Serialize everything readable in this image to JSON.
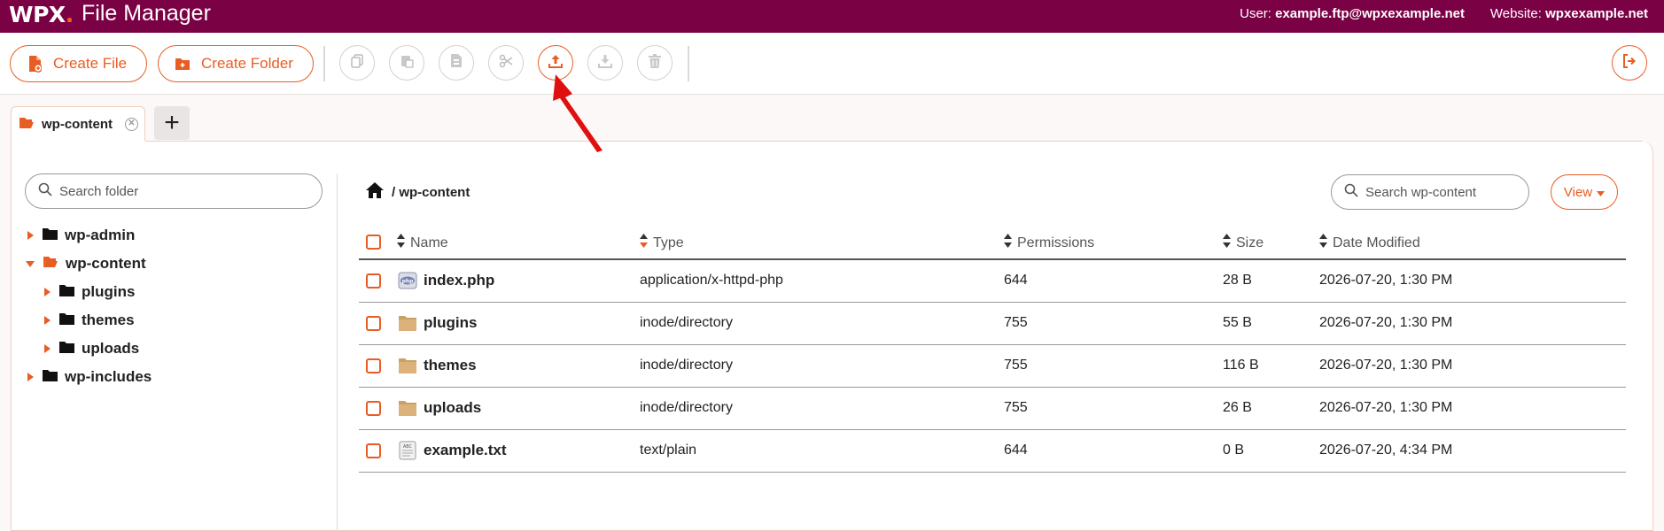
{
  "app": {
    "logo": "WPX",
    "logo_dot": ".",
    "title": "File Manager",
    "user_label": "User:",
    "user_value": "example.ftp@wpxexample.net",
    "website_label": "Website:",
    "website_value": "wpxexample.net"
  },
  "toolbar": {
    "create_file": "Create File",
    "create_folder": "Create Folder"
  },
  "tabs": [
    {
      "label": "wp-content"
    }
  ],
  "sidebar": {
    "search_placeholder": "Search folder",
    "tree": [
      {
        "label": "wp-admin",
        "level": 0,
        "expanded": false
      },
      {
        "label": "wp-content",
        "level": 0,
        "expanded": true
      },
      {
        "label": "plugins",
        "level": 1,
        "expanded": false
      },
      {
        "label": "themes",
        "level": 1,
        "expanded": false
      },
      {
        "label": "uploads",
        "level": 1,
        "expanded": false
      },
      {
        "label": "wp-includes",
        "level": 0,
        "expanded": false
      }
    ]
  },
  "main": {
    "breadcrumb": "/ wp-content",
    "search_placeholder": "Search wp-content",
    "view_label": "View",
    "columns": [
      "Name",
      "Type",
      "Permissions",
      "Size",
      "Date Modified"
    ],
    "rows": [
      {
        "icon": "php-file-icon",
        "name": "index.php",
        "type": "application/x-httpd-php",
        "permissions": "644",
        "size": "28 B",
        "modified": "2026-07-20, 1:30 PM"
      },
      {
        "icon": "folder-icon",
        "name": "plugins",
        "type": "inode/directory",
        "permissions": "755",
        "size": "55 B",
        "modified": "2026-07-20, 1:30 PM"
      },
      {
        "icon": "folder-icon",
        "name": "themes",
        "type": "inode/directory",
        "permissions": "755",
        "size": "116 B",
        "modified": "2026-07-20, 1:30 PM"
      },
      {
        "icon": "folder-icon",
        "name": "uploads",
        "type": "inode/directory",
        "permissions": "755",
        "size": "26 B",
        "modified": "2026-07-20, 1:30 PM"
      },
      {
        "icon": "text-file-icon",
        "name": "example.txt",
        "type": "text/plain",
        "permissions": "644",
        "size": "0 B",
        "modified": "2026-07-20, 4:34 PM"
      }
    ]
  },
  "colors": {
    "header_bg": "#7b0145",
    "accent": "#e85d24"
  }
}
